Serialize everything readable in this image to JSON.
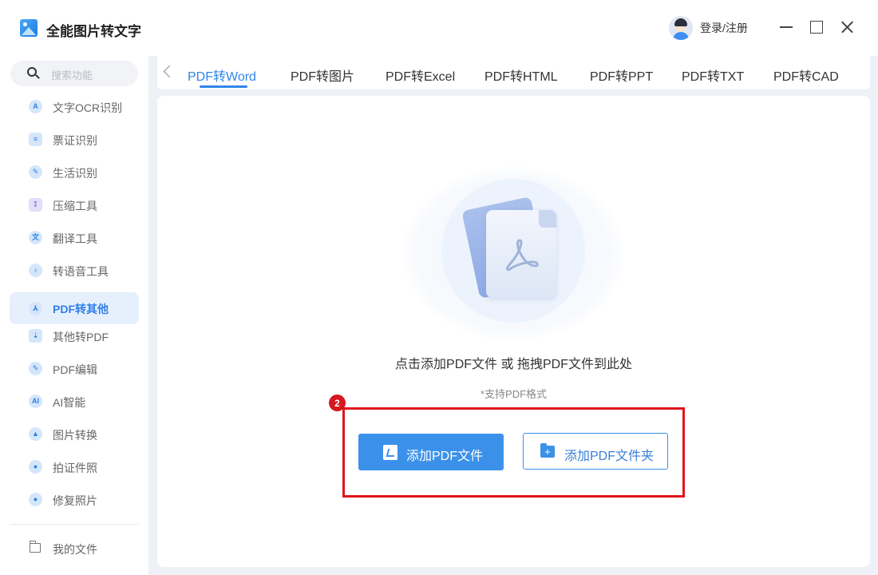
{
  "app": {
    "title": "全能图片转文字",
    "login_label": "登录/注册"
  },
  "sidebar": {
    "search_placeholder": "搜索功能",
    "items": [
      {
        "label": "文字OCR识别",
        "icon": "ocr-icon",
        "glyph": "A"
      },
      {
        "label": "票证识别",
        "icon": "ticket-icon",
        "glyph": "≡"
      },
      {
        "label": "生活识别",
        "icon": "pen-icon",
        "glyph": "✎"
      },
      {
        "label": "压缩工具",
        "icon": "compress-icon",
        "glyph": "⁑"
      },
      {
        "label": "翻译工具",
        "icon": "translate-icon",
        "glyph": "文"
      },
      {
        "label": "转语音工具",
        "icon": "music-icon",
        "glyph": "♪"
      },
      {
        "label": "PDF转其他",
        "icon": "pdf-convert-icon",
        "glyph": "⅄"
      },
      {
        "label": "其他转PDF",
        "icon": "to-pdf-icon",
        "glyph": "⇣"
      },
      {
        "label": "PDF编辑",
        "icon": "edit-icon",
        "glyph": "✎"
      },
      {
        "label": "AI智能",
        "icon": "ai-icon",
        "glyph": "AI"
      },
      {
        "label": "图片转换",
        "icon": "image-icon",
        "glyph": "▲"
      },
      {
        "label": "拍证件照",
        "icon": "camera-icon",
        "glyph": "●"
      },
      {
        "label": "修复照片",
        "icon": "person-icon",
        "glyph": "●"
      }
    ],
    "active_index": 6,
    "files_label": "我的文件"
  },
  "tabs": {
    "items": [
      "PDF转Word",
      "PDF转图片",
      "PDF转Excel",
      "PDF转HTML",
      "PDF转PPT",
      "PDF转TXT",
      "PDF转CAD"
    ],
    "active": "PDF转Word"
  },
  "main": {
    "drop_hint": "点击添加PDF文件 或 拖拽PDF文件到此处",
    "format_hint": "*支持PDF格式",
    "add_file_label": "添加PDF文件",
    "add_folder_label": "添加PDF文件夹",
    "step_badge": "2"
  },
  "colors": {
    "accent": "#2f86ea",
    "highlight": "#e0141d",
    "background": "#eef2f7"
  }
}
